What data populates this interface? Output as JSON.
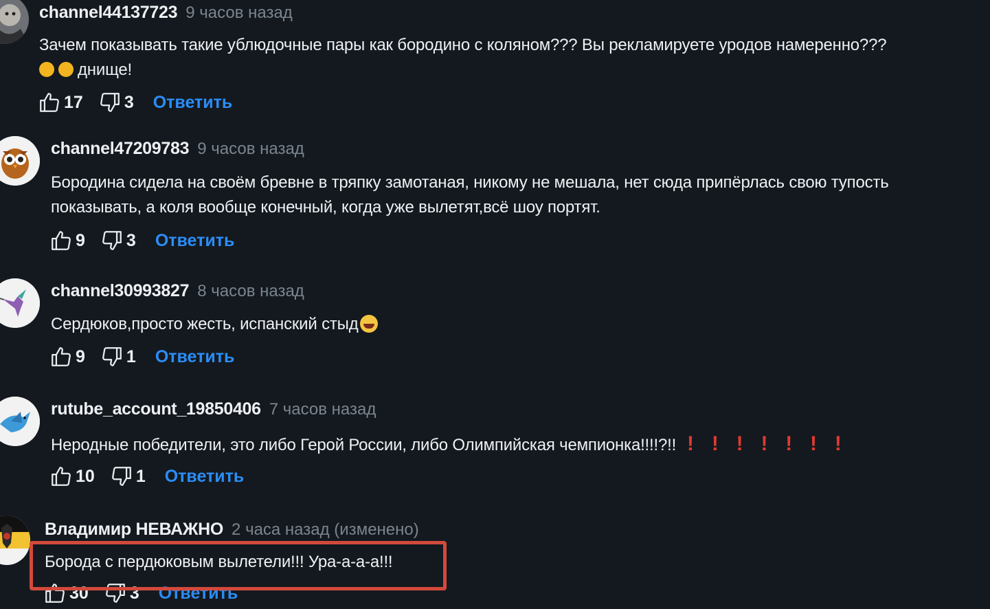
{
  "colors": {
    "background": "#14191f",
    "reply": "#2b8df6",
    "highlight": "#d24a3c",
    "exclamation": "#e03a30"
  },
  "comments": [
    {
      "author": "channel44137723",
      "time": "9 часов назад",
      "lines": [
        "Зачем показывать такие ублюдочные пары как бородино с коляном??? Вы рекламируете  уродов намеренно???",
        "днище!"
      ],
      "likes": "17",
      "dislikes": "3",
      "reply": "Ответить",
      "avatar_icon": "joker-avatar-icon"
    },
    {
      "author": "channel47209783",
      "time": "9 часов назад",
      "lines": [
        "Бородина сидела на своём бревне в тряпку замотаная, никому не мешала, нет сюда припёрлась свою тупость",
        "показывать, а коля вообще конечный, когда уже вылетят,всё шоу портят."
      ],
      "likes": "9",
      "dislikes": "3",
      "reply": "Ответить",
      "avatar_icon": "owl-avatar-icon"
    },
    {
      "author": "channel30993827",
      "time": "8 часов назад",
      "lines": [
        "Сердюков,просто жесть, испанский стыд"
      ],
      "likes": "9",
      "dislikes": "1",
      "reply": "Ответить",
      "avatar_icon": "hummingbird-avatar-icon"
    },
    {
      "author": "rutube_account_19850406",
      "time": "7 часов назад",
      "lines": [
        "Неродные победители, это либо Герой России, либо Олимпийская чемпионка!!!!?!!"
      ],
      "exclamations": [
        "!",
        "!",
        "!",
        "!",
        "!",
        "!",
        "!"
      ],
      "likes": "10",
      "dislikes": "1",
      "reply": "Ответить",
      "avatar_icon": "bird-avatar-icon"
    },
    {
      "author": "Владимир НЕВАЖНО",
      "time": "2 часа назад (изменено)",
      "lines": [
        "Борода с пердюковым вылетели!!! Ура-а-а-а!!!"
      ],
      "likes": "30",
      "dislikes": "3",
      "reply": "Ответить",
      "avatar_icon": "imperial-flag-avatar-icon"
    }
  ]
}
